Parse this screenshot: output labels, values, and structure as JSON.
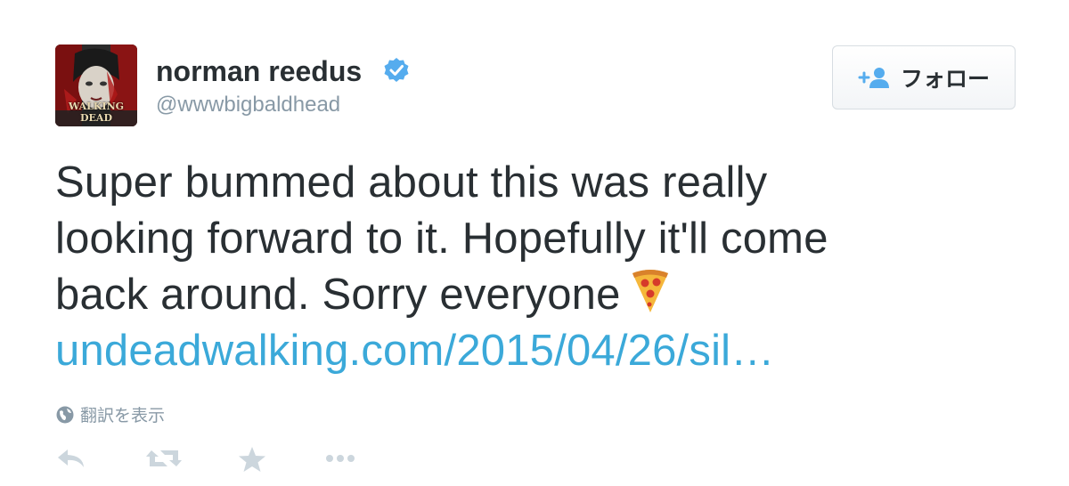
{
  "author": {
    "name": "norman reedus",
    "handle": "@wwwbigbaldhead",
    "avatar_caption": "WALKING DEAD"
  },
  "follow_button": {
    "label": "フォロー"
  },
  "tweet": {
    "lines": [
      "Super bummed about this was really",
      "looking forward to it. Hopefully it'll come",
      "back around. Sorry everyone"
    ],
    "emoji": "pizza",
    "link_text": "undeadwalking.com/2015/04/26/sil…"
  },
  "translate": {
    "label": "翻訳を表示"
  },
  "actions": {
    "icons": [
      "reply-icon",
      "retweet-icon",
      "favorite-icon",
      "more-icon"
    ]
  },
  "colors": {
    "link": "#3ba9d9",
    "verified": "#55acee",
    "secondary_text": "#8899a6",
    "primary_text": "#292f33",
    "action_icon": "#ccd6dd"
  }
}
